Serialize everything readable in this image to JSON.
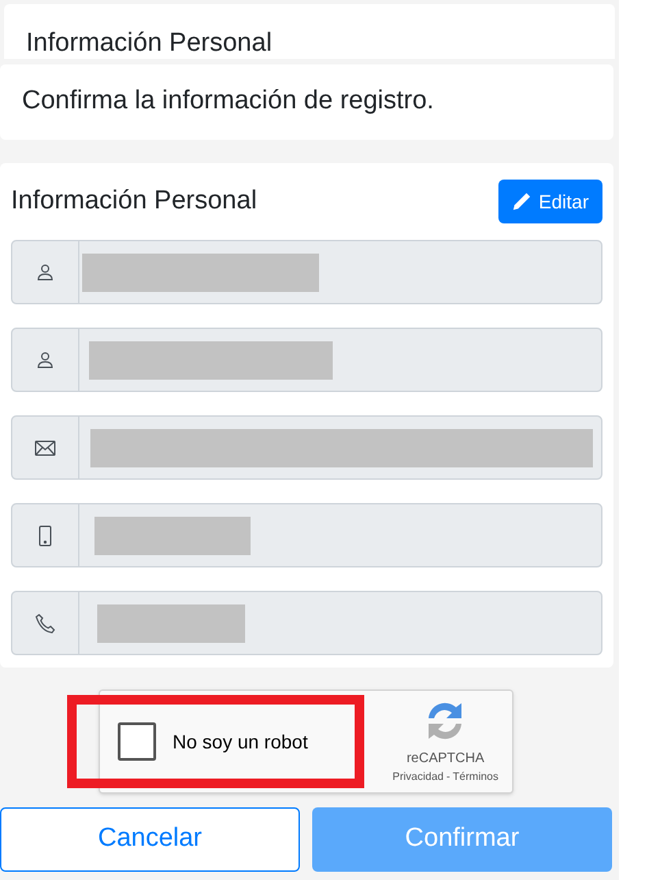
{
  "header_card": {
    "title": "Información Personal"
  },
  "notice": {
    "text": "Confirma la información de registro."
  },
  "personal_info": {
    "title": "Información Personal",
    "edit_button": "Editar",
    "fields": [
      {
        "kind": "person"
      },
      {
        "kind": "person"
      },
      {
        "kind": "email"
      },
      {
        "kind": "mobile"
      },
      {
        "kind": "phone"
      }
    ]
  },
  "captcha": {
    "label": "No soy un robot",
    "checked": false,
    "highlighted": true,
    "brand": "reCAPTCHA",
    "privacy": "Privacidad",
    "separator": "-",
    "terms": "Términos"
  },
  "buttons": {
    "cancel": "Cancelar",
    "confirm": {
      "label": "Confirmar",
      "disabled": true
    }
  }
}
